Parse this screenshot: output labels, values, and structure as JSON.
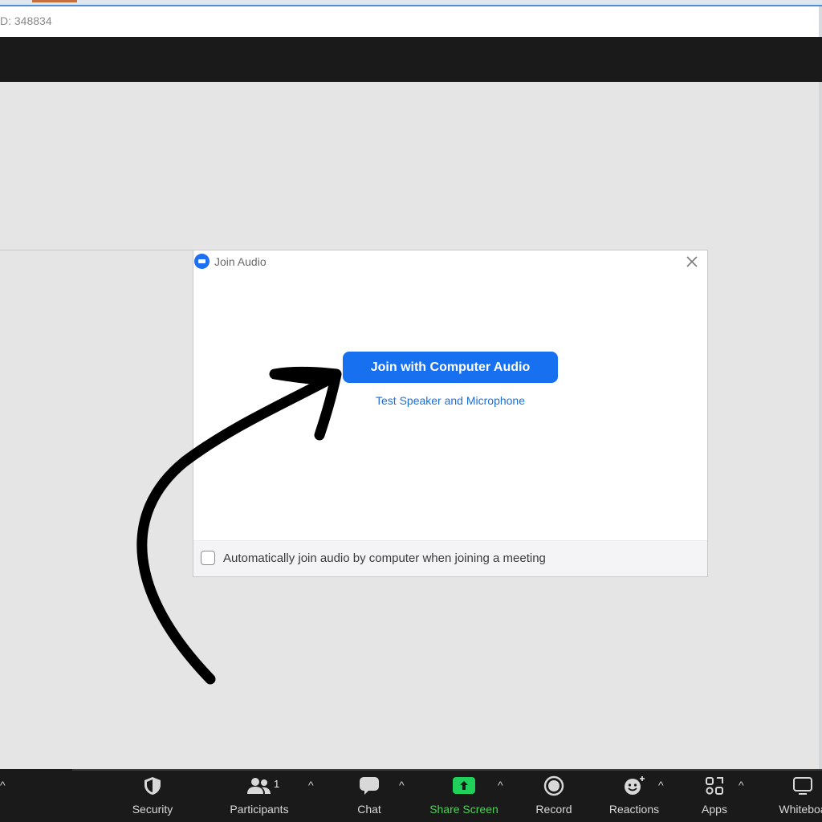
{
  "window": {
    "meeting_id_text": "D: 348834"
  },
  "dialog": {
    "title": "Join Audio",
    "join_button_label": "Join with Computer Audio",
    "test_link_label": "Test Speaker and Microphone",
    "auto_join_label": "Automatically join audio by computer when joining a meeting",
    "auto_join_checked": false
  },
  "toolbar": {
    "items": [
      {
        "label": "Security",
        "icon": "shield-icon"
      },
      {
        "label": "Participants",
        "icon": "participants-icon",
        "count": "1"
      },
      {
        "label": "Chat",
        "icon": "chat-icon"
      },
      {
        "label": "Share Screen",
        "icon": "share-screen-icon"
      },
      {
        "label": "Record",
        "icon": "record-icon"
      },
      {
        "label": "Reactions",
        "icon": "reactions-icon"
      },
      {
        "label": "Apps",
        "icon": "apps-icon"
      },
      {
        "label": "Whiteboa",
        "icon": "whiteboard-icon"
      }
    ],
    "caret_glyph": "^"
  },
  "colors": {
    "accent_blue": "#1670f0",
    "link_blue": "#1a6fd9",
    "share_green": "#1fd05a",
    "toolbar_bg": "#1a1a1a",
    "stage_bg": "#e4e5e4"
  }
}
